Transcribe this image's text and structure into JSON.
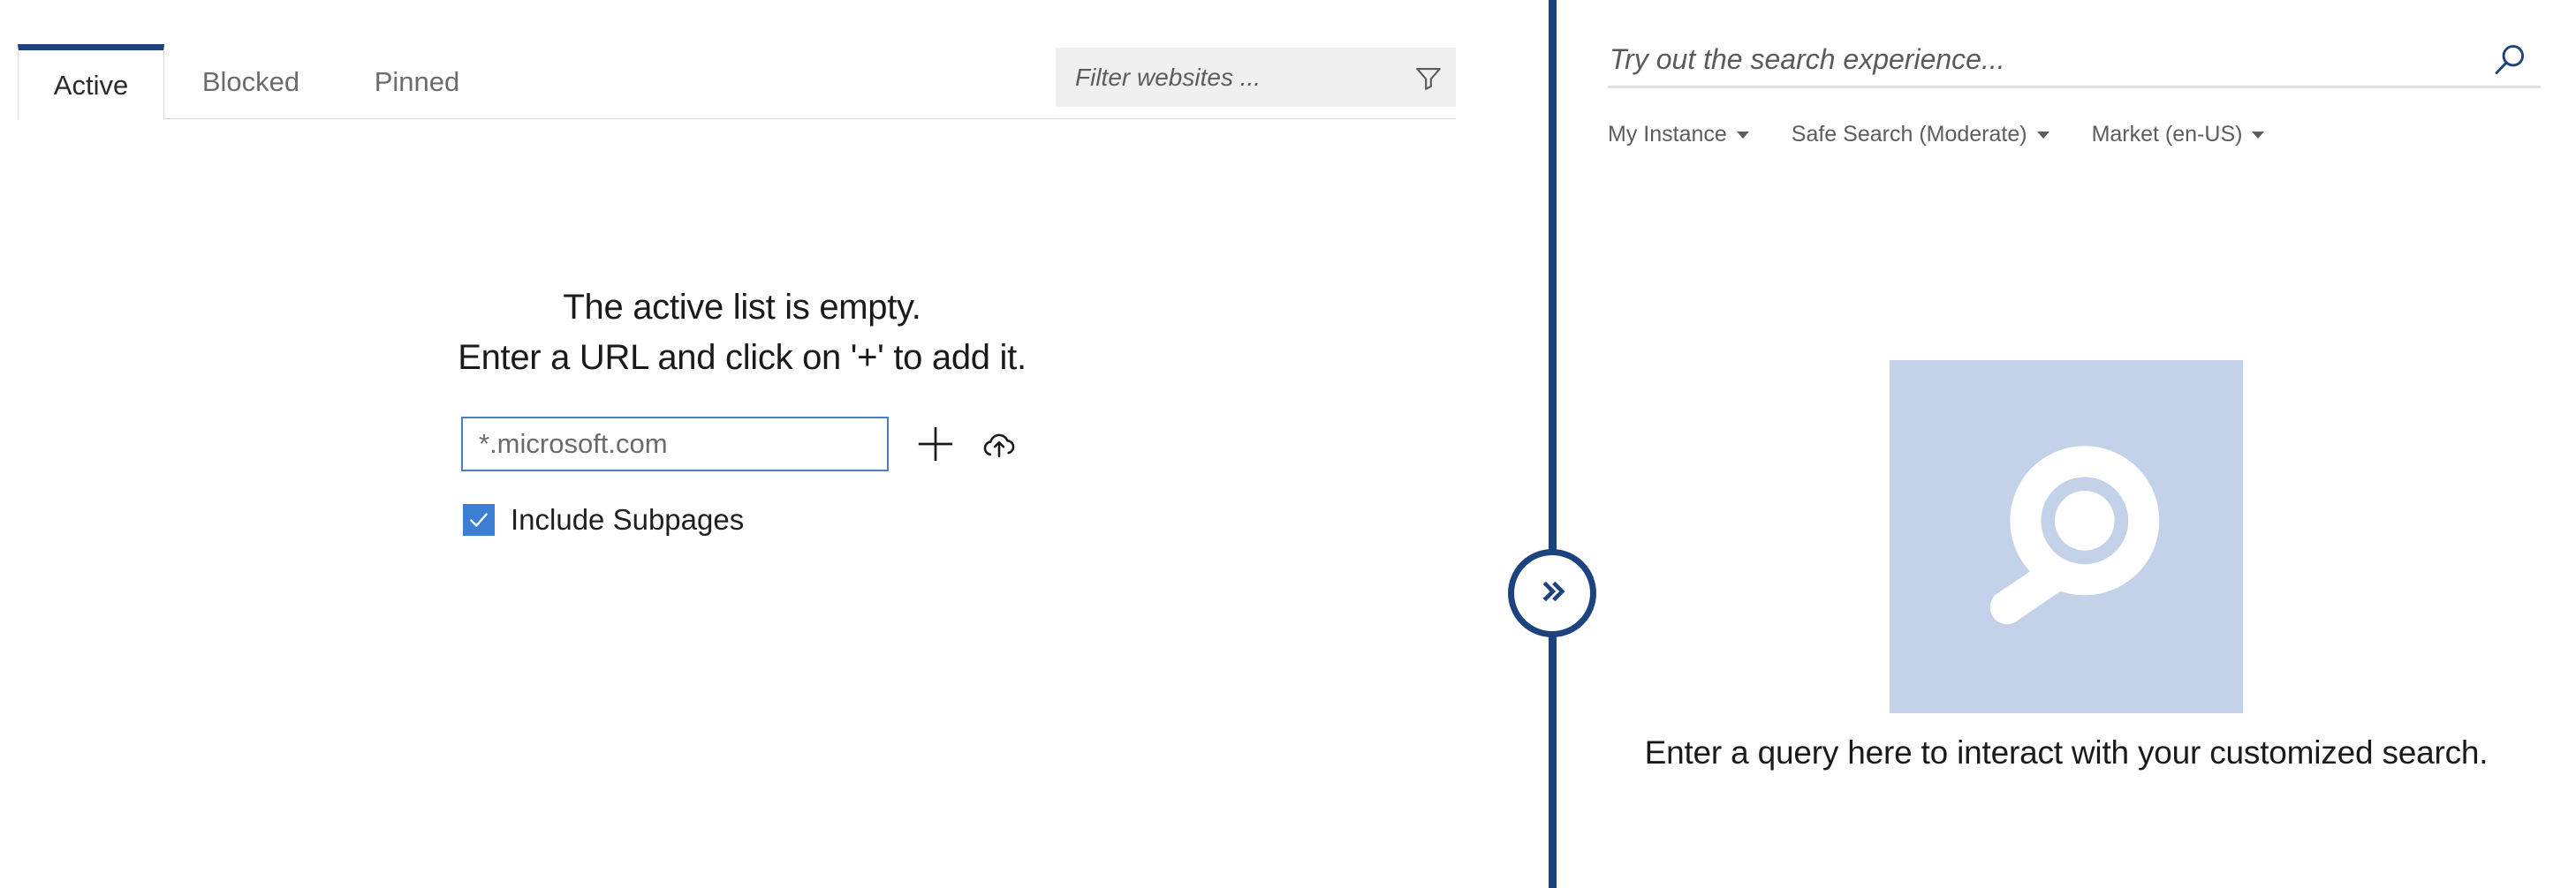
{
  "left_panel": {
    "tabs": [
      {
        "label": "Active",
        "active": true
      },
      {
        "label": "Blocked",
        "active": false
      },
      {
        "label": "Pinned",
        "active": false
      }
    ],
    "filter": {
      "placeholder": "Filter websites ...",
      "value": "",
      "icon": "funnel-icon"
    },
    "empty_state": {
      "line1": "The active list is empty.",
      "line2": "Enter a URL and click on '+' to add it."
    },
    "url_entry": {
      "placeholder": "*.microsoft.com",
      "value": "",
      "add_icon": "plus-icon",
      "cloud_icon": "cloud-upload-icon"
    },
    "include_subpages": {
      "label": "Include Subpages",
      "checked": true,
      "check_glyph": "check-icon"
    }
  },
  "divider": {
    "collapse_button": {
      "icon": "double-chevron-right-icon",
      "glyph": "»"
    }
  },
  "right_panel": {
    "search": {
      "placeholder": "Try out the search experience...",
      "value": "",
      "icon": "search-icon"
    },
    "filters": [
      {
        "label": "My Instance",
        "icon": "chevron-down-icon"
      },
      {
        "label": "Safe Search (Moderate)",
        "icon": "chevron-down-icon"
      },
      {
        "label": "Market (en-US)",
        "icon": "chevron-down-icon"
      }
    ],
    "placeholder": {
      "image_icon": "magnifier-tile-icon",
      "caption": "Enter a query here to interact with your customized search."
    }
  },
  "colors": {
    "brand_navy": "#1d4280",
    "accent_blue": "#3c7ed4",
    "input_border_blue": "#4b7fc0",
    "tile_blue": "#c3d2e9",
    "filter_bg": "#f0f0f0",
    "muted_text": "#5d5d5d",
    "tab_inactive_text": "#6c6c6c"
  }
}
